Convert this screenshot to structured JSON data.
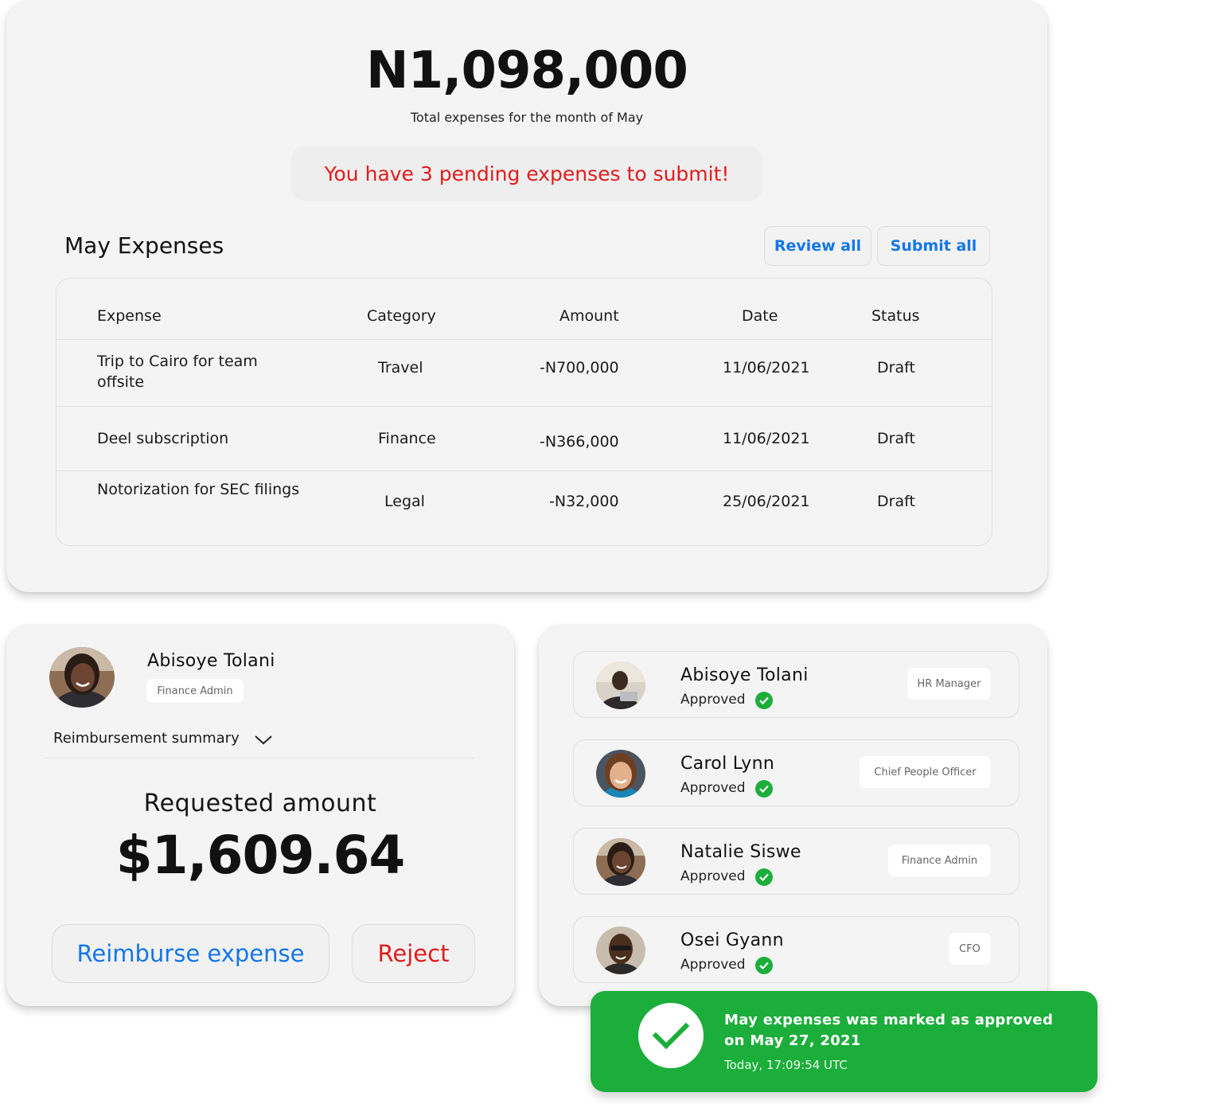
{
  "summary": {
    "total_amount": "N1,098,000",
    "total_caption": "Total expenses for the month of May",
    "pending_message": "You have 3 pending expenses to submit!"
  },
  "expenses": {
    "title": "May Expenses",
    "review_all_label": "Review all",
    "submit_all_label": "Submit all",
    "columns": [
      "Expense",
      "Category",
      "Amount",
      "Date",
      "Status"
    ],
    "rows": [
      {
        "expense": "Trip to Cairo for team offsite",
        "category": "Travel",
        "amount": "-N700,000",
        "date": "11/06/2021",
        "status": "Draft"
      },
      {
        "expense": "Deel subscription",
        "category": "Finance",
        "amount": "-N366,000",
        "date": "11/06/2021",
        "status": "Draft"
      },
      {
        "expense": "Notorization for SEC filings",
        "category": "Legal",
        "amount": "-N32,000",
        "date": "25/06/2021",
        "status": "Draft"
      }
    ]
  },
  "reimbursement": {
    "user_name": "Abisoye Tolani",
    "user_role": "Finance Admin",
    "summary_label": "Reimbursement summary",
    "requested_label": "Requested amount",
    "requested_amount": "$1,609.64",
    "reimburse_label": "Reimburse expense",
    "reject_label": "Reject",
    "colors": {
      "primary": "#1476e8",
      "danger": "#e21c1c"
    }
  },
  "approvers": [
    {
      "name": "Abisoye Tolani",
      "status": "Approved",
      "role": "HR Manager"
    },
    {
      "name": "Carol Lynn",
      "status": "Approved",
      "role": "Chief People Officer"
    },
    {
      "name": "Natalie Siswe",
      "status": "Approved",
      "role": "Finance Admin"
    },
    {
      "name": "Osei Gyann",
      "status": "Approved",
      "role": "CFO"
    }
  ],
  "toast": {
    "message": "May expenses was marked as approved on May 27, 2021",
    "time": "Today, 17:09:54 UTC",
    "color": "#1cae3b"
  }
}
